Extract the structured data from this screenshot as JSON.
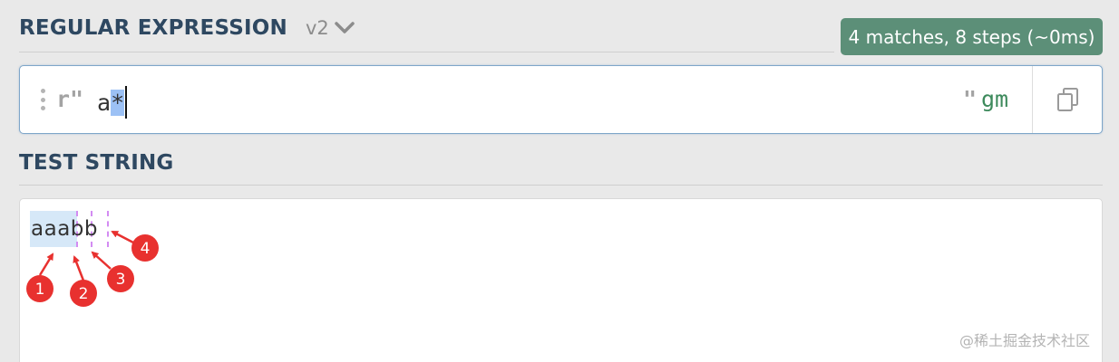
{
  "regex_section": {
    "title": "REGULAR EXPRESSION",
    "flavor": "v2",
    "match_info": "4 matches, 8 steps (~0ms)",
    "delimiter_open": "r\"",
    "pattern_plain": "a",
    "pattern_selected": "*",
    "delimiter_close": "\"",
    "flags": "gm"
  },
  "test_section": {
    "title": "TEST STRING",
    "test_string": "aaabb"
  },
  "annotations": [
    "1",
    "2",
    "3",
    "4"
  ],
  "watermark": "@稀土掘金技术社区",
  "colors": {
    "badge": "#5c8f78",
    "title": "#2e4861",
    "match_highlight": "#d6e8f8",
    "empty_match": "#d38cf2",
    "marker": "#e8312f",
    "flags": "#3d8a5c"
  }
}
